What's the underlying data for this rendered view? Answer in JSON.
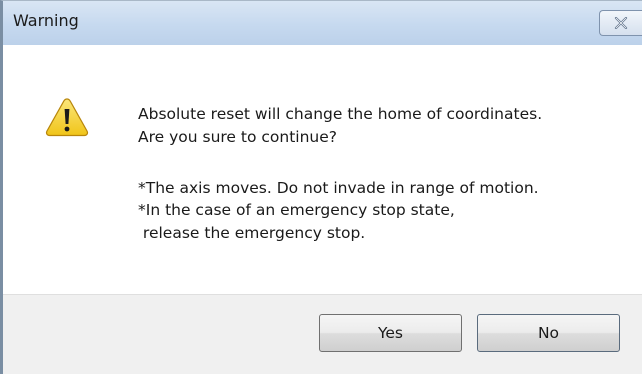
{
  "window": {
    "title": "Warning",
    "close_icon": "close-icon"
  },
  "message": {
    "icon": "warning-triangle-icon",
    "line1": "Absolute reset will change the home of coordinates.",
    "line2": "Are you sure to continue?",
    "note1": "*The axis moves. Do not invade in range of motion.",
    "note2": "*In the case of an emergency stop state,",
    "note3": " release the emergency stop."
  },
  "buttons": {
    "yes_label": "Yes",
    "no_label": "No"
  },
  "colors": {
    "titlebar": "#c6d9ef",
    "warning_fill": "#f7d51d",
    "button_bar": "#f0f0f0"
  }
}
